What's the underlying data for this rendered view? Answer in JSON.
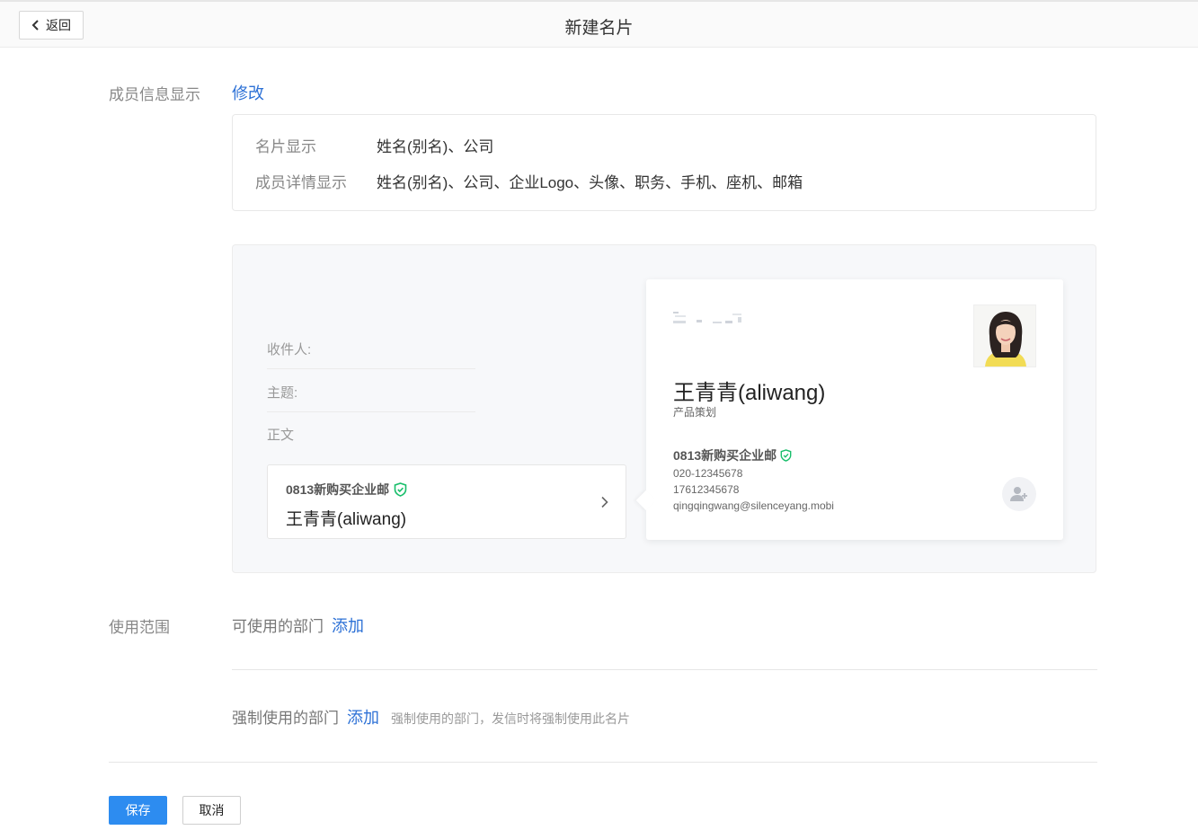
{
  "header": {
    "back_label": "返回",
    "title": "新建名片"
  },
  "member_info": {
    "label": "成员信息显示",
    "edit_link": "修改",
    "rows": [
      {
        "key": "名片显示",
        "value": "姓名(别名)、公司"
      },
      {
        "key": "成员详情显示",
        "value": "姓名(别名)、公司、企业Logo、头像、职务、手机、座机、邮箱"
      }
    ]
  },
  "preview": {
    "mail_fields": {
      "to": "收件人:",
      "subject": "主题:",
      "body": "正文"
    },
    "signature": {
      "company": "0813新购买企业邮",
      "name": "王青青(aliwang)"
    },
    "card": {
      "name": "王青青(aliwang)",
      "title": "产品策划",
      "company": "0813新购买企业邮",
      "phone": "020-12345678",
      "mobile": "17612345678",
      "email": "qingqingwang@silenceyang.mobi"
    }
  },
  "scope": {
    "label": "使用范围",
    "available_label": "可使用的部门",
    "available_add": "添加",
    "forced_label": "强制使用的部门",
    "forced_add": "添加",
    "forced_hint": "强制使用的部门，发信时将强制使用此名片"
  },
  "actions": {
    "save": "保存",
    "cancel": "取消"
  },
  "colors": {
    "link": "#2d71d6",
    "primary": "#2d8cf0",
    "verified": "#19be6b"
  }
}
